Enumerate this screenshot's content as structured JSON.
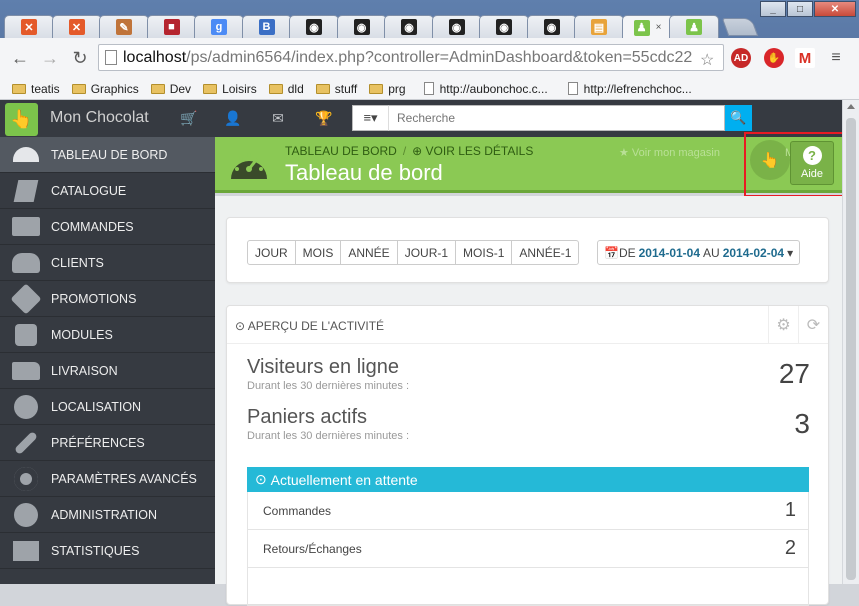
{
  "browser": {
    "url_host": "localhost",
    "url_path": "/ps/admin6564/index.php?controller=AdminDashboard&token=55cdc22",
    "tabs": [
      {
        "icon": "joomla-icon",
        "color": "#e45a2a",
        "glyph": "✕"
      },
      {
        "icon": "joomla-icon",
        "color": "#e45a2a",
        "glyph": "✕"
      },
      {
        "icon": "edit-icon",
        "color": "#c0743a",
        "glyph": "✎"
      },
      {
        "icon": "red-app-icon",
        "color": "#b5252f",
        "glyph": "■"
      },
      {
        "icon": "google-icon",
        "color": "#4c8bf5",
        "glyph": "g"
      },
      {
        "icon": "b-icon",
        "color": "#3b6fc5",
        "glyph": "B"
      },
      {
        "icon": "eye-icon",
        "color": "#222222",
        "glyph": "◉"
      },
      {
        "icon": "eye-icon",
        "color": "#222222",
        "glyph": "◉"
      },
      {
        "icon": "eye-icon",
        "color": "#222222",
        "glyph": "◉"
      },
      {
        "icon": "eye-icon",
        "color": "#222222",
        "glyph": "◉"
      },
      {
        "icon": "eye-icon",
        "color": "#222222",
        "glyph": "◉"
      },
      {
        "icon": "eye-icon",
        "color": "#222222",
        "glyph": "◉"
      },
      {
        "icon": "phpmyadmin-icon",
        "color": "#e8a33a",
        "glyph": "▤"
      },
      {
        "icon": "prestashop-icon",
        "color": "#7cc44b",
        "glyph": "♟"
      },
      {
        "icon": "prestashop-icon",
        "color": "#7cc44b",
        "glyph": "♟"
      }
    ],
    "active_tab_close": "×",
    "bookmarks": [
      {
        "label": "teatis",
        "kind": "folder"
      },
      {
        "label": "Graphics",
        "kind": "folder"
      },
      {
        "label": "Dev",
        "kind": "folder"
      },
      {
        "label": "Loisirs",
        "kind": "folder"
      },
      {
        "label": "dld",
        "kind": "folder"
      },
      {
        "label": "stuff",
        "kind": "folder"
      },
      {
        "label": "prg",
        "kind": "folder"
      },
      {
        "label": "http://aubonchoc.c...",
        "kind": "page"
      },
      {
        "label": "http://lefrenchchoc...",
        "kind": "page"
      }
    ]
  },
  "header": {
    "shop_name": "Mon Chocolat",
    "search_placeholder": "Recherche",
    "search_scope_glyph": "≡▾",
    "icons": [
      "cart-icon",
      "user-icon",
      "mail-icon",
      "trophy-icon"
    ]
  },
  "sidebar": {
    "items": [
      {
        "label": "TABLEAU DE BORD",
        "icon": "dashboard-icon",
        "active": true
      },
      {
        "label": "CATALOGUE",
        "icon": "book-icon"
      },
      {
        "label": "COMMANDES",
        "icon": "credit-card-icon"
      },
      {
        "label": "CLIENTS",
        "icon": "users-icon"
      },
      {
        "label": "PROMOTIONS",
        "icon": "tags-icon"
      },
      {
        "label": "MODULES",
        "icon": "puzzle-icon"
      },
      {
        "label": "LIVRAISON",
        "icon": "truck-icon"
      },
      {
        "label": "LOCALISATION",
        "icon": "globe-icon"
      },
      {
        "label": "PRÉFÉRENCES",
        "icon": "wrench-icon"
      },
      {
        "label": "PARAMÈTRES AVANCÉS",
        "icon": "cogs-icon"
      },
      {
        "label": "ADMINISTRATION",
        "icon": "cog-icon"
      },
      {
        "label": "STATISTIQUES",
        "icon": "bar-chart-icon"
      }
    ]
  },
  "page_head": {
    "breadcrumb": "TABLEAU DE BORD",
    "breadcrumb_sep": "/",
    "view_details": "VOIR LES DÉTAILS",
    "title": "Tableau de bord",
    "view_shop": "Voir mon magasin",
    "mode_label": "Mo",
    "help_label": "Aide"
  },
  "range": {
    "buttons": [
      "JOUR",
      "MOIS",
      "ANNÉE",
      "JOUR-1",
      "MOIS-1",
      "ANNÉE-1"
    ],
    "prefix": "DE",
    "from": "2014-01-04",
    "middle": "AU",
    "to": "2014-02-04"
  },
  "activity": {
    "title": "APERÇU DE L'ACTIVITÉ",
    "visitors_label": "Visiteurs en ligne",
    "visitors_sub": "Durant les 30 dernières minutes :",
    "visitors_value": "27",
    "carts_label": "Paniers actifs",
    "carts_sub": "Durant les 30 dernières minutes :",
    "carts_value": "3",
    "pending_title": "Actuellement en attente",
    "pending": [
      {
        "label": "Commandes",
        "value": "1"
      },
      {
        "label": "Retours/Échanges",
        "value": "2"
      }
    ]
  },
  "colors": {
    "ps_green": "#8bc954",
    "ps_dark": "#363a41",
    "accent_blue": "#25b9d7",
    "highlight_red": "#e81b23"
  }
}
